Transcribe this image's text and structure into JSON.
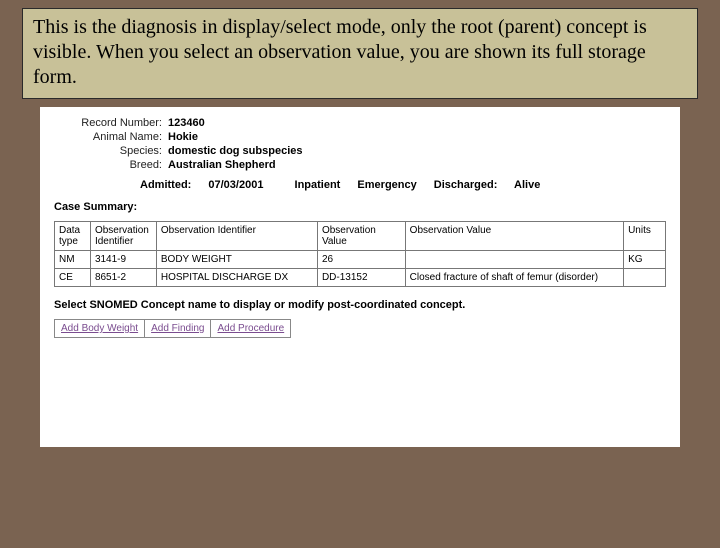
{
  "caption": "This is the diagnosis in display/select mode, only the root (parent) concept is visible.  When you select an observation value, you are shown its full storage form.",
  "meta": {
    "record_label": "Record Number:",
    "record_value": "123460",
    "animal_label": "Animal Name:",
    "animal_value": "Hokie",
    "species_label": "Species:",
    "species_value": "domestic dog subspecies",
    "breed_label": "Breed:",
    "breed_value": "Australian Shepherd"
  },
  "admit": {
    "admitted_label": "Admitted:",
    "admitted_value": "07/03/2001",
    "inpatient": "Inpatient",
    "emergency": "Emergency",
    "discharged_label": "Discharged:",
    "discharged_value": "Alive"
  },
  "case_summary_label": "Case Summary:",
  "table": {
    "headers": {
      "data_type": "Data type",
      "obs_id": "Observation Identifier",
      "obs_id_name": "Observation Identifier",
      "obs_val": "Observation Value",
      "obs_val_name": "Observation Value",
      "units": "Units"
    },
    "rows": [
      {
        "dt": "NM",
        "oid": "3141-9",
        "oidn": "BODY WEIGHT",
        "ov": "26",
        "ovn": "",
        "u": "KG"
      },
      {
        "dt": "CE",
        "oid": "8651-2",
        "oidn": "HOSPITAL DISCHARGE DX",
        "ov": "DD-13152",
        "ovn": "Closed fracture of shaft of femur (disorder)",
        "u": ""
      }
    ]
  },
  "post_instruction": "Select SNOMED Concept name to display or modify post-coordinated concept.",
  "actions": {
    "add_body_weight": "Add Body Weight",
    "add_finding": "Add Finding",
    "add_procedure": "Add Procedure"
  }
}
